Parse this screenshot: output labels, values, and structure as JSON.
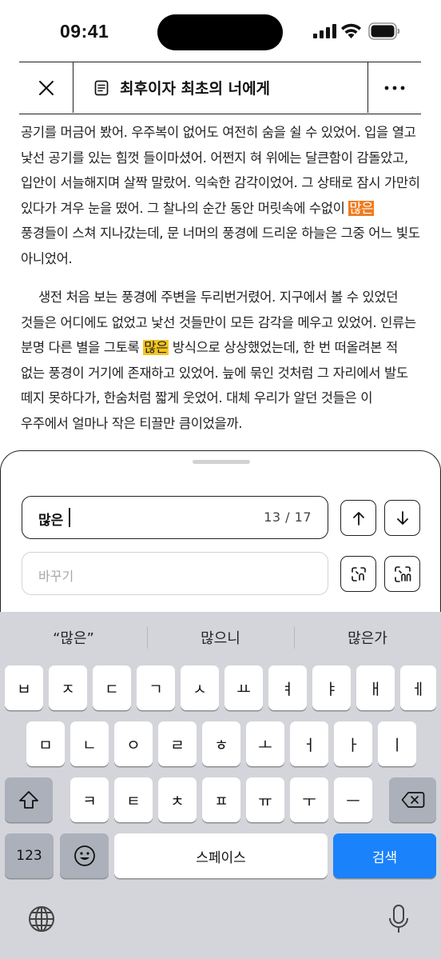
{
  "status_bar": {
    "time": "09:41"
  },
  "header": {
    "title": "최후이자 최초의 너에게"
  },
  "content": {
    "p1": {
      "before": "공기를 머금어 봤어. 우주복이 없어도 여전히 숨을 쉴 수 있었어. 입을 열고 낯선 공기를 있는 힘껏 들이마셨어. 어쩐지 혀 위에는 달큰함이 감돌았고, 입안이 서늘해지며 살짝 말랐어. 익숙한 감각이었어. 그 상태로 잠시 가만히 있다가 겨우 눈을 떴어. 그 찰나의 순간 동안 머릿속에 수없이 ",
      "match": "많은",
      "after": " 풍경들이 스쳐 지나갔는데, 문 너머의 풍경에 드리운 하늘은 그중 어느 빛도 아니었어."
    },
    "p2": {
      "before": "생전 처음 보는 풍경에 주변을 두리번거렸어. 지구에서 볼 수 있었던 것들은 어디에도 없었고 낯선 것들만이 모든 감각을 메우고 있었어. 인류는 분명 다른 별을 그토록 ",
      "match": "많은",
      "after": " 방식으로 상상했었는데, 한 번 떠올려본 적 없는 풍경이 거기에 존재하고 있었어. 늪에 묶인 것처럼 그 자리에서 발도 떼지 못하다가, 한숨처럼 짧게 웃었어. 대체 우리가 알던 것들은 이 우주에서 얼마나 작은 티끌만 큼이었을까."
    }
  },
  "find": {
    "query": "많은",
    "counter": "13 / 17",
    "replace_placeholder": "바꾸기"
  },
  "keyboard": {
    "suggestions": [
      "“많은”",
      "많으니",
      "많은가"
    ],
    "row1": [
      "ㅂ",
      "ㅈ",
      "ㄷ",
      "ㄱ",
      "ㅅ",
      "ㅛ",
      "ㅕ",
      "ㅑ",
      "ㅐ",
      "ㅔ"
    ],
    "row2": [
      "ㅁ",
      "ㄴ",
      "ㅇ",
      "ㄹ",
      "ㅎ",
      "ㅗ",
      "ㅓ",
      "ㅏ",
      "ㅣ"
    ],
    "row3": [
      "ㅋ",
      "ㅌ",
      "ㅊ",
      "ㅍ",
      "ㅠ",
      "ㅜ",
      "ㅡ"
    ],
    "num_label": "123",
    "space_label": "스페이스",
    "search_label": "검색"
  }
}
